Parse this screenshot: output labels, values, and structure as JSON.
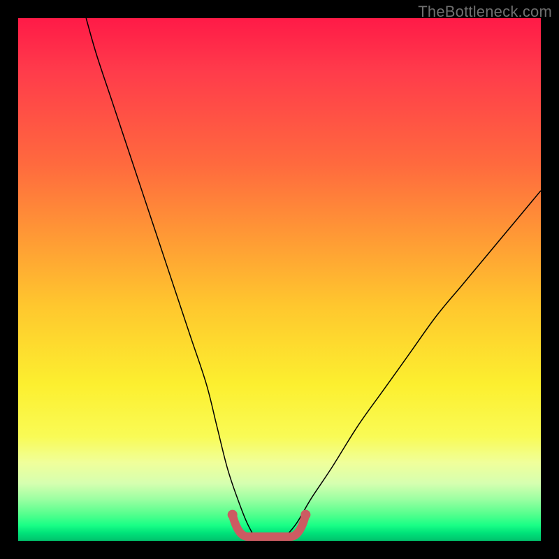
{
  "watermark": "TheBottleneck.com",
  "chart_data": {
    "type": "line",
    "title": "",
    "xlabel": "",
    "ylabel": "",
    "xlim": [
      0,
      100
    ],
    "ylim": [
      0,
      100
    ],
    "grid": false,
    "legend": false,
    "background_gradient": {
      "direction": "vertical",
      "stops": [
        {
          "pos": 0,
          "color": "#ff1a47"
        },
        {
          "pos": 40,
          "color": "#ff9a35"
        },
        {
          "pos": 70,
          "color": "#fcef2f"
        },
        {
          "pos": 90,
          "color": "#9cffa2"
        },
        {
          "pos": 100,
          "color": "#00c26c"
        }
      ]
    },
    "series": [
      {
        "name": "bottleneck-curve",
        "x": [
          13,
          15,
          18,
          21,
          24,
          27,
          30,
          33,
          36,
          38,
          40,
          42,
          44,
          46,
          48,
          50,
          53,
          56,
          60,
          65,
          70,
          75,
          80,
          85,
          90,
          95,
          100
        ],
        "y": [
          100,
          93,
          84,
          75,
          66,
          57,
          48,
          39,
          30,
          22,
          14,
          8,
          3,
          0,
          0,
          0,
          3,
          8,
          14,
          22,
          29,
          36,
          43,
          49,
          55,
          61,
          67
        ]
      }
    ],
    "highlight": {
      "name": "flat-minimum-segment",
      "x_range": [
        41,
        55
      ],
      "y": 0,
      "color": "#cc5b62"
    }
  }
}
